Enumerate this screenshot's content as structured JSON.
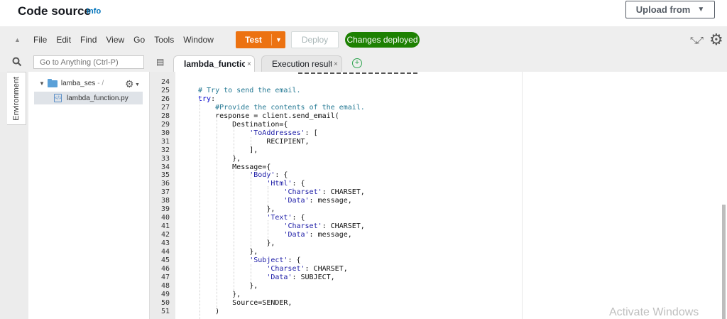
{
  "header": {
    "title": "Code source",
    "info": "Info",
    "upload_button": "Upload from",
    "upload_caret": "▼"
  },
  "toolbar": {
    "menu": [
      "File",
      "Edit",
      "Find",
      "View",
      "Go",
      "Tools",
      "Window"
    ],
    "test_label": "Test",
    "deploy_label": "Deploy",
    "status_badge": "Changes deployed"
  },
  "search": {
    "placeholder": "Go to Anything (Ctrl-P)"
  },
  "tabs": [
    {
      "label": "lambda_function",
      "close": "×"
    },
    {
      "label": "Execution results",
      "close": "×"
    }
  ],
  "sidebar": {
    "environment_label": "Environment"
  },
  "file_tree": {
    "folder": "lamba_ses",
    "folder_suffix": "- /",
    "file": "lambda_function.py"
  },
  "editor": {
    "line_numbers": [
      "24",
      "25",
      "26",
      "27",
      "28",
      "29",
      "30",
      "31",
      "32",
      "33",
      "34",
      "35",
      "36",
      "37",
      "38",
      "39",
      "40",
      "41",
      "42",
      "43",
      "44",
      "45",
      "46",
      "47",
      "48",
      "49",
      "50",
      "51"
    ],
    "lines": [
      "",
      "# Try to send the email.",
      "try:",
      "    #Provide the contents of the email.",
      "    response = client.send_email(",
      "        Destination={",
      "            'ToAddresses': [",
      "                RECIPIENT,",
      "            ],",
      "        },",
      "        Message={",
      "            'Body': {",
      "                'Html': {",
      "                    'Charset': CHARSET,",
      "                    'Data': message,",
      "                },",
      "                'Text': {",
      "                    'Charset': CHARSET,",
      "                    'Data': message,",
      "                },",
      "            },",
      "            'Subject': {",
      "                'Charset': CHARSET,",
      "                'Data': SUBJECT,",
      "            },",
      "        },",
      "        Source=SENDER,",
      "    )"
    ]
  },
  "watermark": "Activate Windows"
}
